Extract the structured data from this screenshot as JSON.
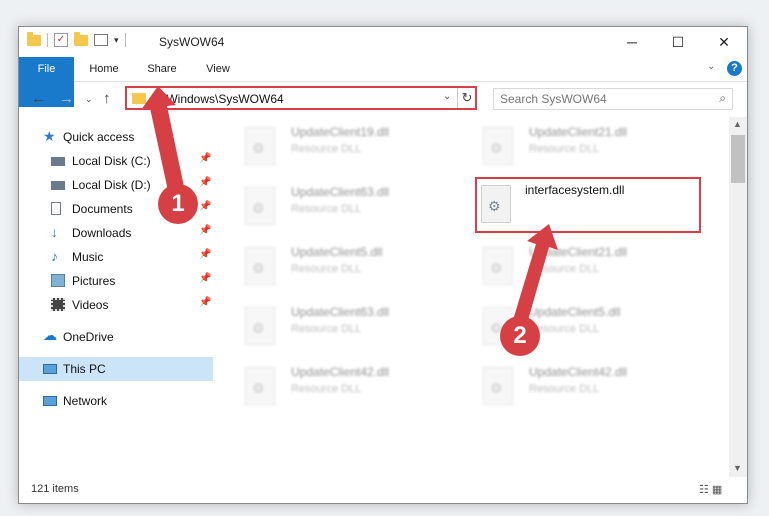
{
  "window": {
    "title": "SysWOW64",
    "controls": {
      "minimize": "─",
      "maximize": "☐",
      "close": "✕"
    }
  },
  "ribbon": {
    "tabs": [
      "File",
      "Home",
      "Share",
      "View"
    ],
    "help": "?"
  },
  "address": {
    "path": "C:\\Windows\\SysWOW64",
    "refresh": "↻",
    "dropdown": "⌄"
  },
  "search": {
    "placeholder": "Search SysWOW64",
    "icon": "search-icon"
  },
  "sidebar": {
    "items": [
      {
        "label": "Quick access",
        "icon": "star-icon"
      },
      {
        "label": "Local Disk (C:)",
        "icon": "drive-icon"
      },
      {
        "label": "Local Disk (D:)",
        "icon": "drive-icon"
      },
      {
        "label": "Documents",
        "icon": "documents-icon"
      },
      {
        "label": "Downloads",
        "icon": "download-icon"
      },
      {
        "label": "Music",
        "icon": "music-icon"
      },
      {
        "label": "Pictures",
        "icon": "pictures-icon"
      },
      {
        "label": "Videos",
        "icon": "videos-icon"
      },
      {
        "label": "OneDrive",
        "icon": "cloud-icon"
      },
      {
        "label": "This PC",
        "icon": "computer-icon"
      },
      {
        "label": "Network",
        "icon": "network-icon"
      }
    ]
  },
  "files": [
    {
      "name": "UpdateClient19.dll",
      "type": "Resource DLL"
    },
    {
      "name": "UpdateClient21.dll",
      "type": "Resource DLL"
    },
    {
      "name": "UpdateClient63.dll",
      "type": "Resource DLL"
    },
    {
      "name": "interfacesystem.dll",
      "type": ""
    },
    {
      "name": "UpdateClient5.dll",
      "type": "Resource DLL"
    },
    {
      "name": "UpdateClient21.dll",
      "type": "Resource DLL"
    },
    {
      "name": "UpdateClient63.dll",
      "type": "Resource DLL"
    },
    {
      "name": "UpdateClient5.dll",
      "type": "Resource DLL"
    },
    {
      "name": "UpdateClient42.dll",
      "type": "Resource DLL"
    },
    {
      "name": "UpdateClient42.dll",
      "type": "Resource DLL"
    }
  ],
  "status": {
    "item_count": "121 items"
  },
  "annotations": {
    "step1": "1",
    "step2": "2"
  },
  "colors": {
    "accent": "#1979ca",
    "highlight": "#d64045",
    "selected": "#cce4f7"
  }
}
